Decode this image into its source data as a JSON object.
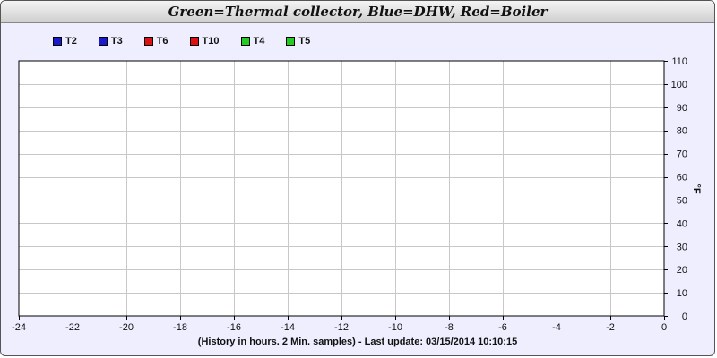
{
  "title": "Green=Thermal collector, Blue=DHW, Red=Boiler",
  "legend": [
    {
      "label": "T2",
      "color": "#1a1acc"
    },
    {
      "label": "T3",
      "color": "#1a1acc"
    },
    {
      "label": "T6",
      "color": "#dd1111"
    },
    {
      "label": "T10",
      "color": "#dd1111"
    },
    {
      "label": "T4",
      "color": "#22cc22"
    },
    {
      "label": "T5",
      "color": "#22cc22"
    }
  ],
  "footer": "(History in hours. 2 Min. samples) - Last update: 03/15/2014 10:10:15",
  "chart_data": {
    "type": "line",
    "xlabel": "",
    "ylabel": "°F",
    "xlim": [
      -24,
      0
    ],
    "ylim": [
      0,
      110
    ],
    "xticks": [
      -24,
      -22,
      -20,
      -18,
      -16,
      -14,
      -12,
      -10,
      -8,
      -6,
      -4,
      -2,
      0
    ],
    "yticks": [
      0,
      10,
      20,
      30,
      40,
      50,
      60,
      70,
      80,
      90,
      100,
      110
    ],
    "grid": true,
    "legend_position": "top-left",
    "series": [
      {
        "name": "T2",
        "values": []
      },
      {
        "name": "T3",
        "values": []
      },
      {
        "name": "T6",
        "values": []
      },
      {
        "name": "T10",
        "values": []
      },
      {
        "name": "T4",
        "values": []
      },
      {
        "name": "T5",
        "values": []
      }
    ]
  }
}
